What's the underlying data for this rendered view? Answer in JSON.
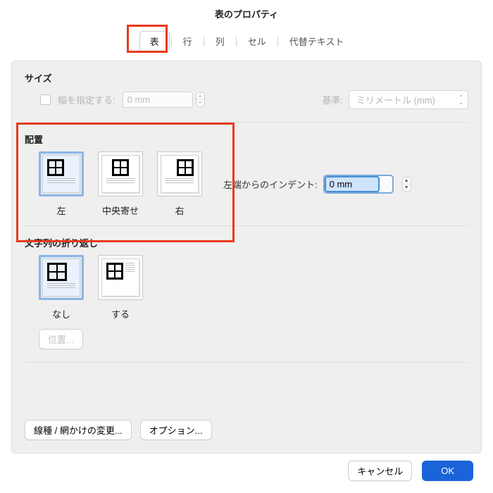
{
  "title": "表のプロパティ",
  "tabs": {
    "table": "表",
    "row": "行",
    "column": "列",
    "cell": "セル",
    "alt": "代替テキスト"
  },
  "size": {
    "heading": "サイズ",
    "specify_label": "幅を指定する:",
    "width_value": "0 mm",
    "basis_label": "基準:",
    "basis_value": "ミリメートル (mm)"
  },
  "alignment": {
    "heading": "配置",
    "left": "左",
    "center": "中央寄せ",
    "right": "右",
    "indent_label": "左端からのインデント:",
    "indent_value": "0 mm"
  },
  "wrap": {
    "heading": "文字列の折り返し",
    "none": "なし",
    "do": "する",
    "position_btn": "位置..."
  },
  "buttons": {
    "borders": "線種 / 網かけの変更...",
    "options": "オプション...",
    "cancel": "キャンセル",
    "ok": "OK"
  }
}
